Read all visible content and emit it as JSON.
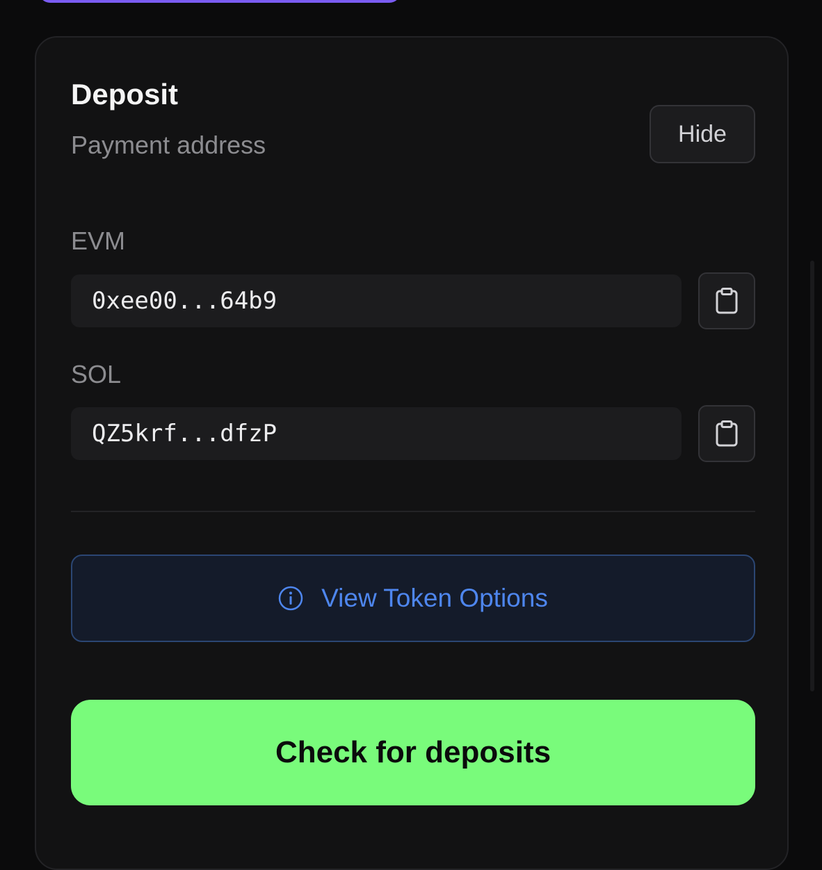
{
  "deposit": {
    "title": "Deposit",
    "subtitle": "Payment address",
    "hide_label": "Hide"
  },
  "addresses": [
    {
      "label": "EVM",
      "value": "0xee00...64b9",
      "copy_icon": "clipboard-icon"
    },
    {
      "label": "SOL",
      "value": "QZ5krf...dfzP",
      "copy_icon": "clipboard-icon"
    }
  ],
  "token_options": {
    "icon": "info-icon",
    "label": "View Token Options"
  },
  "check_button": {
    "label": "Check for deposits"
  },
  "colors": {
    "background": "#0b0b0c",
    "card": "#121213",
    "accent_green": "#79fb7b",
    "accent_blue": "#4e86ee",
    "accent_purple": "#7a5cf2"
  }
}
